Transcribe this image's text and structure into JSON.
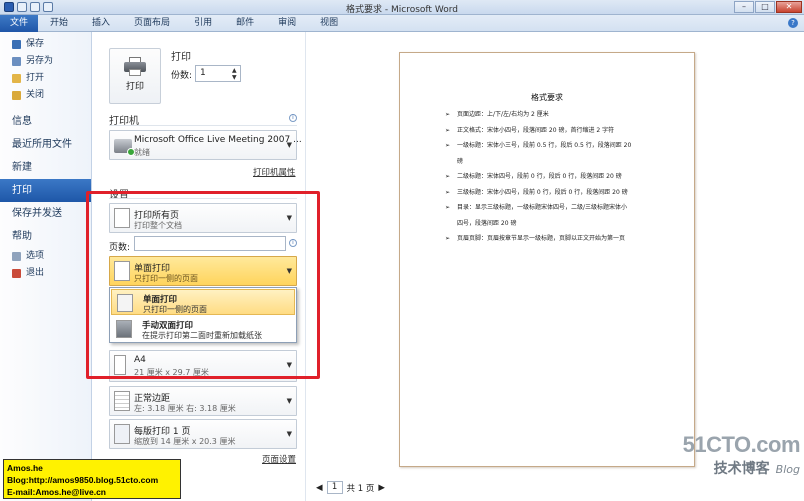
{
  "window": {
    "title": "格式要求 - Microsoft Word"
  },
  "ribbon_tabs": [
    "文件",
    "开始",
    "插入",
    "页面布局",
    "引用",
    "邮件",
    "审阅",
    "视图"
  ],
  "nav": {
    "items_top": [
      {
        "label": "保存",
        "icon": "save-icon",
        "color": "#3a6fb5"
      },
      {
        "label": "另存为",
        "icon": "save-as-icon",
        "color": "#6b8fc0"
      },
      {
        "label": "打开",
        "icon": "folder-open-icon",
        "color": "#e3b548"
      },
      {
        "label": "关闭",
        "icon": "folder-close-icon",
        "color": "#d9a93b"
      }
    ],
    "sections": [
      "信息",
      "最近所用文件",
      "新建",
      "打印",
      "保存并发送",
      "帮助"
    ],
    "active_section": "打印",
    "items_bottom": [
      {
        "label": "选项",
        "icon": "options-icon",
        "color": "#8fa3bd"
      },
      {
        "label": "退出",
        "icon": "exit-icon",
        "color": "#c94b3a"
      }
    ]
  },
  "print": {
    "heading": "打印",
    "button_label": "打印",
    "copies_label": "份数:",
    "copies_value": "1",
    "printer_heading": "打印机",
    "printer_name": "Microsoft Office Live Meeting 2007 ...",
    "printer_status": "就绪",
    "printer_properties": "打印机属性",
    "settings_heading": "设置",
    "range": {
      "title": "打印所有页",
      "subtitle": "打印整个文档"
    },
    "pages_label": "页数:",
    "sides": {
      "title": "单面打印",
      "subtitle": "只打印一侧的页面"
    },
    "sides_options": [
      {
        "title": "单面打印",
        "subtitle": "只打印一侧的页面"
      },
      {
        "title": "手动双面打印",
        "subtitle": "在提示打印第二面时重新加载纸张"
      }
    ],
    "paper": {
      "title": "A4",
      "subtitle": "21 厘米 x 29.7 厘米"
    },
    "margins": {
      "title": "正常边距",
      "subtitle": "左: 3.18 厘米    右: 3.18 厘米"
    },
    "per_sheet": {
      "title": "每版打印 1 页",
      "subtitle": "缩放到 14 厘米 x 20.3 厘米"
    },
    "page_setup": "页面设置"
  },
  "preview": {
    "doc_title": "格式要求",
    "bullets": [
      "页面边距：上/下/左/右均为 2 厘米",
      "正文格式：宋体小四号，段落间距 20 磅，首行缩进 2 字符",
      "一级标题：宋体小三号，段前 0.5 行，段后 0.5 行，段落间距 20",
      "磅",
      "二级标题：宋体四号，段前 0 行，段后 0 行，段落间距 20 磅",
      "三级标题：宋体小四号，段前 0 行，段后 0 行，段落间距 20 磅",
      "目录：显示三级标题，一级标题宋体四号，二级/三级标题宋体小",
      "四号，段落间距 20 磅",
      "页眉页脚：页眉按章节显示一级标题，页脚以正文开始为第一页"
    ],
    "page_current": "1",
    "page_total": "共 1 页"
  },
  "watermark": {
    "brand": "51CTO.com",
    "sub": "技术博客",
    "blog": "Blog"
  },
  "caption": {
    "line1": "Amos.he",
    "line2": "Blog:http://amos9850.blog.51cto.com",
    "line3": "E-mail:Amos.he@live.cn"
  }
}
